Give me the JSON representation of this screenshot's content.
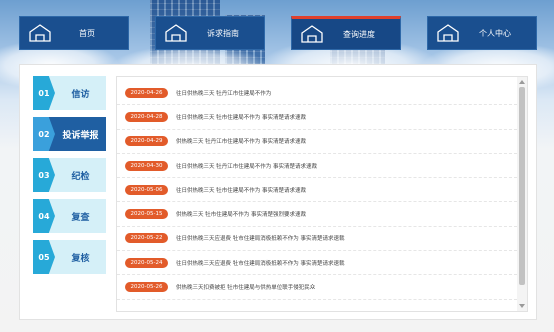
{
  "nav": {
    "items": [
      {
        "label": "首页",
        "icon": "home-icon",
        "active": false
      },
      {
        "label": "诉求指南",
        "icon": "home-icon",
        "active": false
      },
      {
        "label": "查询进度",
        "icon": "home-icon",
        "active": true
      },
      {
        "label": "个人中心",
        "icon": "home-icon",
        "active": false
      }
    ]
  },
  "side": {
    "items": [
      {
        "num": "01",
        "label": "信访",
        "active": false
      },
      {
        "num": "02",
        "label": "投诉举报",
        "active": true
      },
      {
        "num": "03",
        "label": "纪检",
        "active": false
      },
      {
        "num": "04",
        "label": "复查",
        "active": false
      },
      {
        "num": "05",
        "label": "复核",
        "active": false
      }
    ]
  },
  "list": {
    "rows": [
      {
        "date": "2020-04-26",
        "title": "往日供热晚三天 牡丹江市住建局不作为"
      },
      {
        "date": "2020-04-28",
        "title": "往日供热晚三天 牡市住建局不作为 事实清楚请求速裁"
      },
      {
        "date": "2020-04-29",
        "title": "供热晚三天 牡丹江市住建局不作为 事实清楚请求速裁"
      },
      {
        "date": "2020-04-30",
        "title": "往日供热晚三天 牡丹江市住建局不作为 事实清楚请求速裁"
      },
      {
        "date": "2020-05-06",
        "title": "往日供热晚三天 牡市住建局不作为 事实清楚请求速裁"
      },
      {
        "date": "2020-05-15",
        "title": "供热晚三天 牡市住建局不作为 事实清楚强烈要求速裁"
      },
      {
        "date": "2020-05-22",
        "title": "往日供热晚三天应退费 牡市住建局消极抵赖不作为 事实清楚请求速裁"
      },
      {
        "date": "2020-05-24",
        "title": "往日供热晚三天应退费 牡市住建局消极抵赖不作为 事实清楚请求速裁"
      },
      {
        "date": "2020-05-26",
        "title": "供热晚三天扣费被拒 牡市住建局与供热单位联手侵犯民众"
      }
    ]
  },
  "colors": {
    "nav_bg": "#1a4f8f",
    "active_accent": "#e0402c",
    "date_badge": "#e25b2a",
    "side_active": "#1f5fa2",
    "side_num": "#27a9d8"
  }
}
